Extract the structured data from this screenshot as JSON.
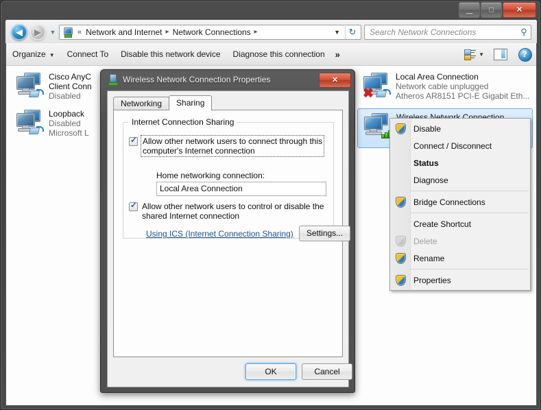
{
  "window": {
    "controls": {
      "minimize": "─",
      "maximize": "□",
      "close": "✕"
    }
  },
  "addressbar": {
    "back_icon": "◀",
    "forward_icon": "▶",
    "recent_dropdown_icon": "▼",
    "crumb_root_icon": "network-icon",
    "chevron_prefix": "«",
    "crumbs": [
      "Network and Internet",
      "Network Connections"
    ],
    "separator": "▸",
    "dropdown_icon": "▼",
    "refresh_icon": "↻",
    "search_placeholder": "Search Network Connections",
    "search_value": "",
    "search_icon": "⚲"
  },
  "toolbar": {
    "organize": "Organize",
    "organize_caret": "▼",
    "connect_to": "Connect To",
    "disable_device": "Disable this network device",
    "diagnose": "Diagnose this connection",
    "overflow": "»",
    "view_caret": "▼",
    "help_glyph": "?"
  },
  "connections": [
    {
      "name": "Cisco AnyC",
      "name2": "Client Conn",
      "status": "Disabled",
      "device": "",
      "icon": "network-adapter-disabled-icon",
      "selected": false
    },
    {
      "name": "Loopback",
      "name2": "",
      "status": "Disabled",
      "device": "Microsoft L",
      "icon": "network-adapter-disabled-icon",
      "selected": false
    },
    {
      "name": "Local Area Connection",
      "name2": "",
      "status": "Network cable unplugged",
      "device": "Atheros AR8151 PCI-E Gigabit Eth...",
      "icon": "network-adapter-unplugged-icon",
      "selected": false
    },
    {
      "name": "Wireless Network Connection",
      "name2": "",
      "status": "",
      "device": "",
      "icon": "wireless-adapter-icon",
      "selected": true
    }
  ],
  "context_menu": {
    "items": [
      {
        "label": "Disable",
        "shield": true,
        "bold": false,
        "disabled": false
      },
      {
        "label": "Connect / Disconnect",
        "shield": false,
        "bold": false,
        "disabled": false
      },
      {
        "label": "Status",
        "shield": false,
        "bold": true,
        "disabled": false
      },
      {
        "label": "Diagnose",
        "shield": false,
        "bold": false,
        "disabled": false
      },
      {
        "separator": true
      },
      {
        "label": "Bridge Connections",
        "shield": true,
        "bold": false,
        "disabled": false
      },
      {
        "separator": true
      },
      {
        "label": "Create Shortcut",
        "shield": false,
        "bold": false,
        "disabled": false
      },
      {
        "label": "Delete",
        "shield": true,
        "shield_disabled": true,
        "bold": false,
        "disabled": true
      },
      {
        "label": "Rename",
        "shield": true,
        "bold": false,
        "disabled": false
      },
      {
        "separator": true
      },
      {
        "label": "Properties",
        "shield": true,
        "bold": false,
        "disabled": false
      }
    ]
  },
  "dialog": {
    "title": "Wireless Network Connection Properties",
    "icon": "network-connection-icon",
    "close_glyph": "✕",
    "tabs": [
      {
        "label": "Networking",
        "active": false
      },
      {
        "label": "Sharing",
        "active": true
      }
    ],
    "group_title": "Internet Connection Sharing",
    "checkbox1_line1": "Allow other network users to connect through this",
    "checkbox1_line2": "computer's Internet connection",
    "checkbox1_checked": true,
    "home_networking_label": "Home networking connection:",
    "home_networking_value": "Local Area Connection",
    "checkbox2_line1": "Allow other network users to control or disable the",
    "checkbox2_line2": "shared Internet connection",
    "checkbox2_checked": true,
    "ics_link": "Using ICS (Internet Connection Sharing)",
    "settings_button": "Settings...",
    "ok_button": "OK",
    "cancel_button": "Cancel"
  },
  "colors": {
    "accent": "#2a63a8",
    "selection": "#c9e3fb",
    "link": "#1a4f8f",
    "shield_yellow": "#f3c020",
    "shield_blue": "#2f7ac4",
    "close_red": "#cf4f36"
  }
}
